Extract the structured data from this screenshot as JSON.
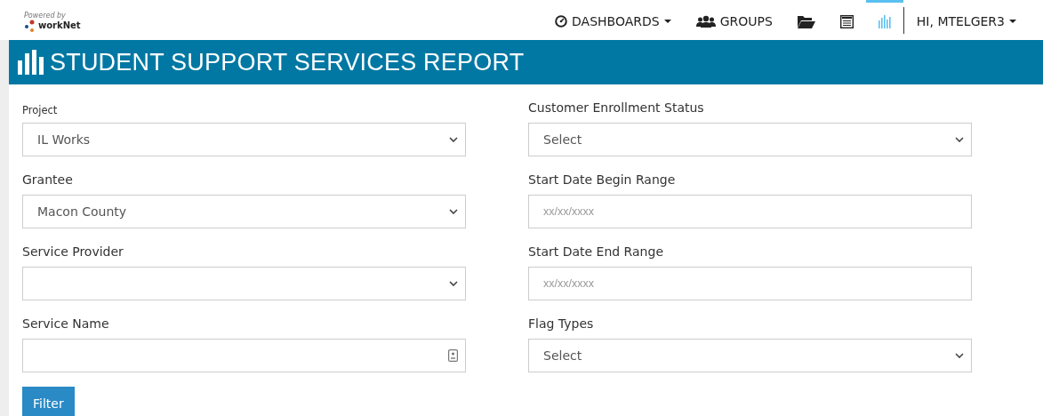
{
  "logo": {
    "tagline": "Powered by",
    "name": "workNet"
  },
  "nav": [
    {
      "kind": "dashboards",
      "label": "DASHBOARDS",
      "caret": true,
      "selected": false
    },
    {
      "kind": "groups",
      "label": "GROUPS",
      "caret": false,
      "selected": false
    },
    {
      "kind": "folder",
      "selected": false
    },
    {
      "kind": "list",
      "selected": false
    },
    {
      "kind": "chart",
      "selected": true
    },
    {
      "kind": "user",
      "label": "HI, MTELGER3",
      "caret": true,
      "selected": false
    }
  ],
  "title": "STUDENT SUPPORT SERVICES REPORT",
  "columns": [
    [
      {
        "label": "Project",
        "small": true,
        "kind": "select",
        "value": "IL Works"
      },
      {
        "label": "Grantee",
        "kind": "select",
        "value": "Macon County"
      },
      {
        "label": "Service Provider",
        "kind": "select"
      },
      {
        "label": "Service Name",
        "kind": "text-card"
      }
    ],
    [
      {
        "label": "Customer Enrollment Status",
        "kind": "select",
        "value": "Select"
      },
      {
        "label": "Start Date Begin Range",
        "kind": "date",
        "placeholder": "xx/xx/xxxx"
      },
      {
        "label": "Start Date End Range",
        "kind": "date",
        "placeholder": "xx/xx/xxxx"
      },
      {
        "label": "Flag Types",
        "kind": "select",
        "value": "Select"
      }
    ]
  ],
  "button": "Filter"
}
